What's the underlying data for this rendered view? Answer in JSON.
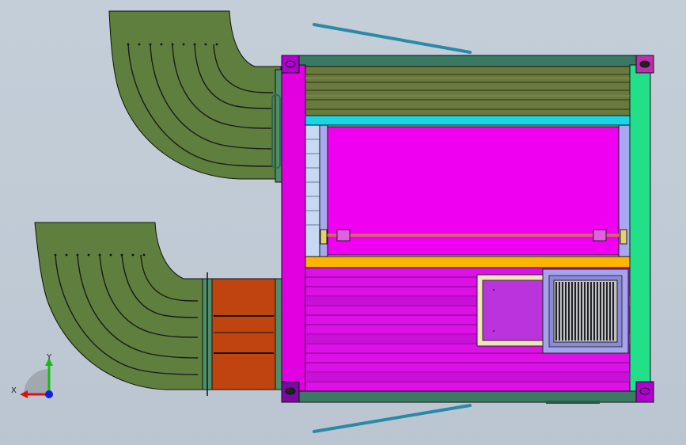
{
  "viewport": {
    "background": "#c0cad5"
  },
  "colors": {
    "duct_green": "#5f7f3e",
    "container_magenta": "#e000e0",
    "panel_magenta": "#f000f0",
    "corner_purple": "#b000d0",
    "frame_teal": "#3a7a62",
    "rail_olive": "#6a7a3e",
    "cyan_strip": "#19d6e6",
    "orange_strip": "#ffb400",
    "side_green": "#22e08a",
    "damper_orange": "#c0440f",
    "vent_lavender": "#a8a8f0",
    "window_purple": "#bb33dd",
    "rod_steel": "#2a8aa6"
  },
  "triad": {
    "x_label": "X",
    "y_label": "Y",
    "x_color": "#e01010",
    "y_color": "#10c010",
    "z_color": "#1020e0"
  }
}
